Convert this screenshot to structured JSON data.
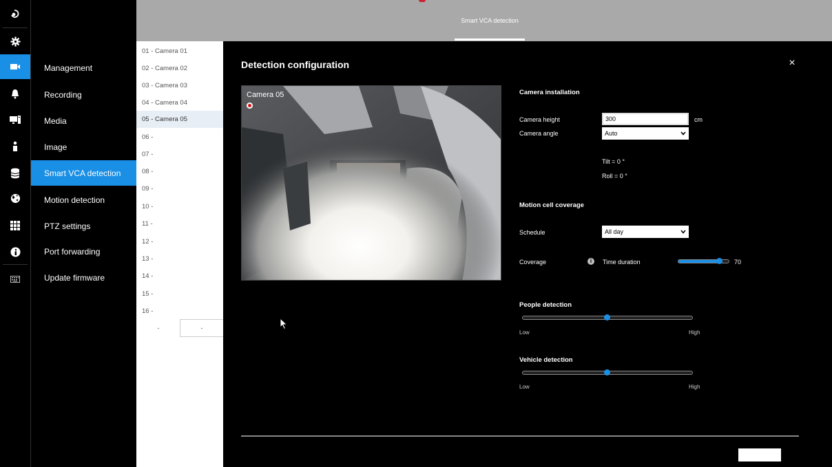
{
  "top_tab": {
    "label": "Smart VCA detection"
  },
  "rail": {
    "icons": [
      "logo-icon",
      "gear-icon",
      "camera-icon",
      "bell-icon",
      "monitor-icon",
      "user-icon",
      "database-icon",
      "globe-icon",
      "grid-icon",
      "info-icon",
      "keyboard-icon"
    ],
    "active_index": 2
  },
  "menu": {
    "items": [
      {
        "label": "Management"
      },
      {
        "label": "Recording"
      },
      {
        "label": "Media"
      },
      {
        "label": "Image"
      },
      {
        "label": "Smart VCA detection"
      },
      {
        "label": "Motion detection"
      },
      {
        "label": "PTZ settings"
      },
      {
        "label": "Port forwarding"
      },
      {
        "label": "Update firmware"
      }
    ],
    "active_index": 4
  },
  "cameras": {
    "items": [
      {
        "label": "01 - Camera 01"
      },
      {
        "label": "02 - Camera 02"
      },
      {
        "label": "03 - Camera 03"
      },
      {
        "label": "04 - Camera 04"
      },
      {
        "label": "05 - Camera 05"
      },
      {
        "label": "06 -"
      },
      {
        "label": "07 -"
      },
      {
        "label": "08 -"
      },
      {
        "label": "09 -"
      },
      {
        "label": "10 -"
      },
      {
        "label": "11 -"
      },
      {
        "label": "12 -"
      },
      {
        "label": "13 -"
      },
      {
        "label": "14 -"
      },
      {
        "label": "15 -"
      },
      {
        "label": "16 -"
      }
    ],
    "active_index": 4,
    "pager": {
      "prev": "-",
      "next": "-"
    }
  },
  "dialog": {
    "title": "Detection configuration",
    "close": "×",
    "video": {
      "camera_label": "Camera 05"
    },
    "camera_installation": {
      "header": "Camera installation",
      "height_label": "Camera height",
      "height_value": "300",
      "height_unit": "cm",
      "angle_label": "Camera angle",
      "angle_value": "Auto",
      "tilt": "Tilt = 0  °",
      "roll": "Roll = 0  °"
    },
    "motion": {
      "header": "Motion cell coverage",
      "schedule_label": "Schedule",
      "schedule_value": "All day",
      "coverage_label": "Coverage",
      "time_duration_label": "Time duration",
      "time_duration_value": "70",
      "time_duration_fraction": 0.82
    },
    "people": {
      "header": "People detection",
      "low": "Low",
      "high": "High",
      "level": 0.5
    },
    "vehicle": {
      "header": "Vehicle detection",
      "low": "Low",
      "high": "High",
      "level": 0.5
    }
  }
}
